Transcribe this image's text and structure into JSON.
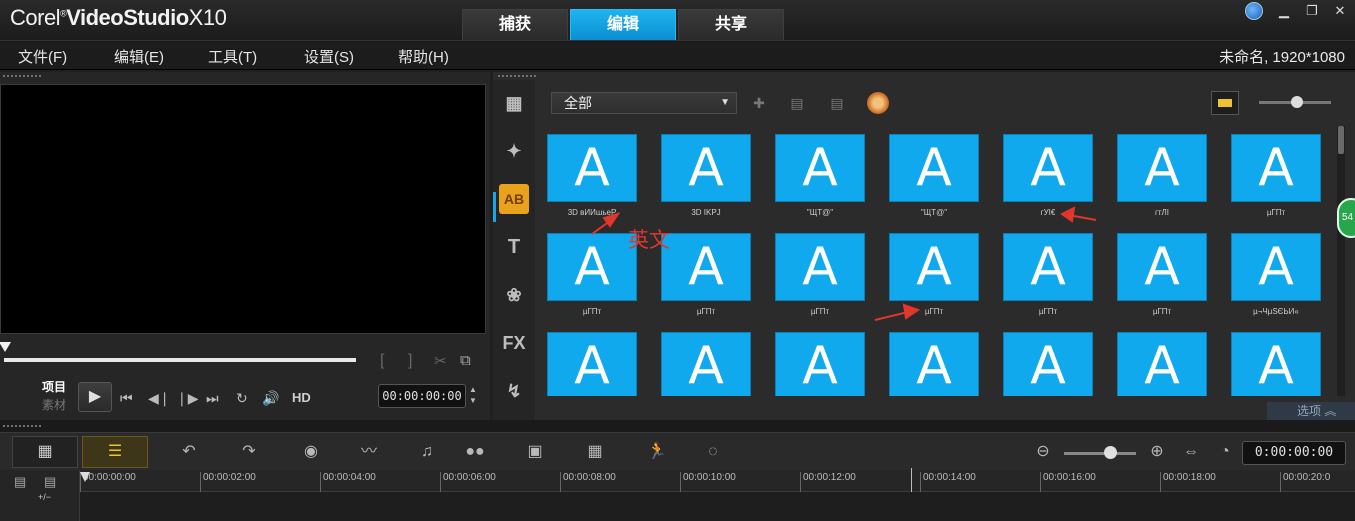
{
  "app": {
    "logo_prefix": "Corel",
    "logo_mark": "®",
    "logo_name": "VideoStudio",
    "logo_version": "X10"
  },
  "tabs": [
    {
      "label": "捕获",
      "active": false
    },
    {
      "label": "编辑",
      "active": true
    },
    {
      "label": "共享",
      "active": false
    }
  ],
  "window_controls": {
    "minimize": "▁",
    "restore": "❐",
    "close": "✕"
  },
  "menu": [
    {
      "label": "文件(F)"
    },
    {
      "label": "编辑(E)"
    },
    {
      "label": "工具(T)"
    },
    {
      "label": "设置(S)"
    },
    {
      "label": "帮助(H)"
    }
  ],
  "project_info": "未命名, 1920*1080",
  "player": {
    "mode_project": "项目",
    "mode_clip": "素材",
    "hd_label": "HD",
    "timecode": "00:00:00:00",
    "controls": [
      "play-icon",
      "skip-start-icon",
      "step-back-icon",
      "step-forward-icon",
      "skip-end-icon",
      "repeat-icon",
      "volume-icon"
    ]
  },
  "library": {
    "filter": "全部",
    "options_label": "选项",
    "side_badge": "54",
    "side_icons": [
      "media-icon",
      "instant-project-icon",
      "transition-icon",
      "title-icon",
      "graphics-icon",
      "fx-icon",
      "path-icon"
    ],
    "title_presets": [
      {
        "glyph": "A",
        "caption": "3D вИИшьеР"
      },
      {
        "glyph": "A",
        "caption": "3D IKPJ"
      },
      {
        "glyph": "A",
        "caption": "\"ЩТ@\""
      },
      {
        "glyph": "A",
        "caption": "\"ЩТ@\""
      },
      {
        "glyph": "A",
        "caption": "гУI€"
      },
      {
        "glyph": "A",
        "caption": "гтЛI"
      },
      {
        "glyph": "A",
        "caption": "µГПт"
      },
      {
        "glyph": "A",
        "caption": "µГПт"
      },
      {
        "glyph": "A",
        "caption": "µГПт"
      },
      {
        "glyph": "A",
        "caption": "µГПт"
      },
      {
        "glyph": "A",
        "caption": "µГПт"
      },
      {
        "glyph": "A",
        "caption": "µГПт"
      },
      {
        "glyph": "A",
        "caption": "µГПт"
      },
      {
        "glyph": "A",
        "caption": "µ¬ЧµЅЄЬИ«"
      },
      {
        "glyph": "A",
        "caption": ""
      },
      {
        "glyph": "A",
        "caption": ""
      },
      {
        "glyph": "A",
        "caption": ""
      },
      {
        "glyph": "A",
        "caption": ""
      },
      {
        "glyph": "A",
        "caption": ""
      },
      {
        "glyph": "A",
        "caption": ""
      },
      {
        "glyph": "A",
        "caption": ""
      }
    ]
  },
  "annotation": {
    "text": "英文"
  },
  "timeline": {
    "timecode": "0:00:00:00",
    "track_add_label": "+/−",
    "ruler": [
      "00:00:00:00",
      "00:00:02:00",
      "00:00:04:00",
      "00:00:06:00",
      "00:00:08:00",
      "00:00:10:00",
      "00:00:12:00",
      "00:00:14:00",
      "00:00:16:00",
      "00:00:18:00",
      "00:00:20:0"
    ]
  }
}
